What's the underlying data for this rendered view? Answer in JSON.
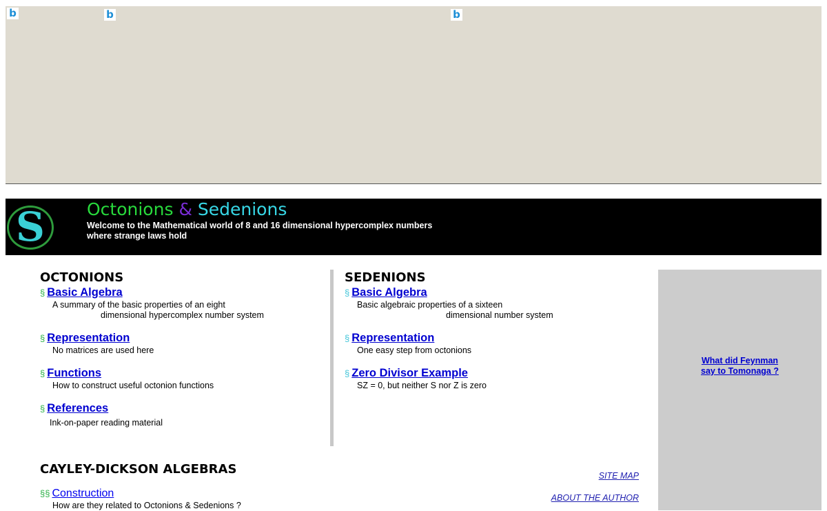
{
  "ad": {
    "icon_glyph": "b",
    "icon_names": [
      "ad-info-icon",
      "ad-info-icon",
      "ad-info-icon"
    ]
  },
  "header": {
    "title_part1": "Octonions",
    "title_amp": "&",
    "title_part2": "Sedenions",
    "tagline_line1": "Welcome to the Mathematical world of 8 and 16 dimensional hypercomplex numbers",
    "tagline_line2": "where strange laws hold",
    "logo_glyph": "S",
    "colors": {
      "octonions": "#28d93c",
      "amp": "#7a2cd6",
      "sedenions": "#37d7e6"
    }
  },
  "octonions": {
    "title": "OCTONIONS",
    "bullet": "§",
    "items": [
      {
        "link": "Basic Algebra",
        "desc1": "A summary of the basic properties of an eight",
        "desc2": "dimensional hypercomplex number system"
      },
      {
        "link": "Representation",
        "desc1": "No matrices are used here"
      },
      {
        "link": "Functions",
        "desc1": "How to construct useful octonion functions"
      },
      {
        "link": "References",
        "desc1": "Ink-on-paper reading material"
      }
    ]
  },
  "sedenions": {
    "title": "SEDENIONS",
    "bullet": "§",
    "items": [
      {
        "link": "Basic Algebra",
        "desc1": "Basic algebraic properties of a sixteen",
        "desc2": "dimensional number system"
      },
      {
        "link": "Representation",
        "desc1": "One easy step from octonions"
      },
      {
        "link": "Zero Divisor Example",
        "desc1": "SZ = 0, but neither S nor Z is zero"
      }
    ]
  },
  "sidebar": {
    "link_line1": "What did Feynman",
    "link_line2": "say to Tomonaga ?"
  },
  "cayley": {
    "title": "CAYLEY-DICKSON ALGEBRAS",
    "bullet": "§§",
    "item": {
      "link": "Construction",
      "desc1": "How are they related to Octonions & Sedenions ?"
    }
  },
  "footer_links": {
    "site_map": "SITE MAP",
    "about": "ABOUT THE AUTHOR"
  }
}
